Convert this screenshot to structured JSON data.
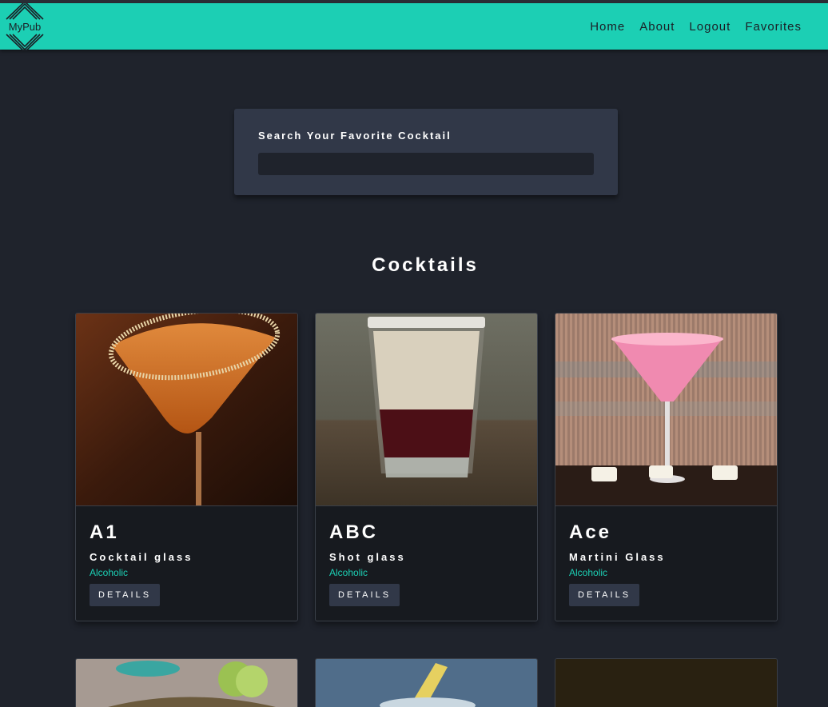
{
  "brand": {
    "name": "MyPub",
    "colors": {
      "accent": "#1ccfb4",
      "background": "#1f232c",
      "panel": "#313848",
      "card": "#171a1f"
    }
  },
  "nav": {
    "items": [
      {
        "label": "Home"
      },
      {
        "label": "About"
      },
      {
        "label": "Logout"
      },
      {
        "label": "Favorites"
      }
    ]
  },
  "search": {
    "label": "Search Your Favorite Cocktail",
    "value": "",
    "placeholder": ""
  },
  "section": {
    "title": "Cocktails"
  },
  "cocktails": [
    {
      "name": "A1",
      "glass": "Cocktail glass",
      "type": "Alcoholic",
      "button": "DETAILS"
    },
    {
      "name": "ABC",
      "glass": "Shot glass",
      "type": "Alcoholic",
      "button": "DETAILS"
    },
    {
      "name": "Ace",
      "glass": "Martini Glass",
      "type": "Alcoholic",
      "button": "DETAILS"
    }
  ]
}
